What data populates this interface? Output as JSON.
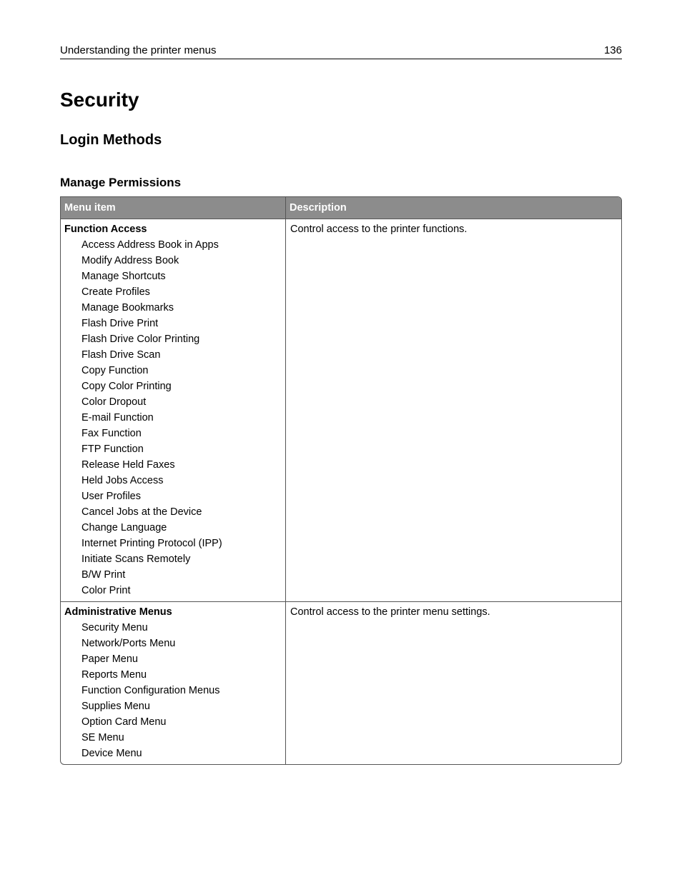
{
  "header": {
    "section_title": "Understanding the printer menus",
    "page_number": "136"
  },
  "headings": {
    "h1": "Security",
    "h2": "Login Methods",
    "h3": "Manage Permissions"
  },
  "table": {
    "columns": [
      "Menu item",
      "Description"
    ],
    "rows": [
      {
        "title": "Function Access",
        "items": [
          "Access Address Book in Apps",
          "Modify Address Book",
          "Manage Shortcuts",
          "Create Profiles",
          "Manage Bookmarks",
          "Flash Drive Print",
          "Flash Drive Color Printing",
          "Flash Drive Scan",
          "Copy Function",
          "Copy Color Printing",
          "Color Dropout",
          "E-mail Function",
          "Fax Function",
          "FTP Function",
          "Release Held Faxes",
          "Held Jobs Access",
          "User Profiles",
          "Cancel Jobs at the Device",
          "Change Language",
          "Internet Printing Protocol (IPP)",
          "Initiate Scans Remotely",
          "B/W Print",
          "Color Print"
        ],
        "description": "Control access to the printer functions."
      },
      {
        "title": "Administrative Menus",
        "items": [
          "Security Menu",
          "Network/Ports Menu",
          "Paper Menu",
          "Reports Menu",
          "Function Configuration Menus",
          "Supplies Menu",
          "Option Card Menu",
          "SE Menu",
          "Device Menu"
        ],
        "description": "Control access to the printer menu settings."
      }
    ]
  }
}
